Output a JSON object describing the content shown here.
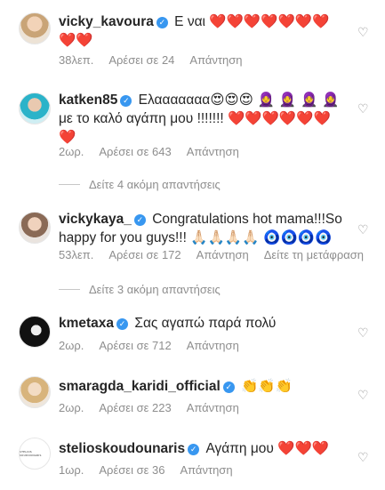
{
  "comments": [
    {
      "username": "vicky_kavoura",
      "text": "Ε ναι",
      "emojis": "❤️❤️❤️❤️❤️❤️❤️❤️❤️",
      "time": "38λεπ.",
      "likes": "Αρέσει σε 24",
      "reply": "Απάντηση",
      "translate": ""
    },
    {
      "username": "katken85",
      "text": "Ελααααααα",
      "emojis": "😍😍😍 🧕 🧕 🧕 🧕",
      "text2": "με το καλό αγάπη μου !!!!!!!",
      "emojis2": "❤️❤️❤️❤️❤️❤️❤️",
      "time": "2ωρ.",
      "likes": "Αρέσει σε 643",
      "reply": "Απάντηση",
      "translate": ""
    },
    {
      "username": "vickykaya_",
      "text": "Congratulations hot mama!!!So happy for you guys!!!",
      "emojis": "🙏🏻🙏🏻🙏🏻🙏🏻 🧿🧿🧿🧿",
      "time": "53λεπ.",
      "likes": "Αρέσει σε 172",
      "reply": "Απάντηση",
      "translate": "Δείτε τη μετάφραση"
    },
    {
      "username": "kmetaxa",
      "text": "Σας αγαπώ παρά πολύ",
      "emojis": "",
      "time": "2ωρ.",
      "likes": "Αρέσει σε 712",
      "reply": "Απάντηση",
      "translate": ""
    },
    {
      "username": "smaragda_karidi_official",
      "text": "",
      "emojis": "👏👏👏",
      "time": "2ωρ.",
      "likes": "Αρέσει σε 223",
      "reply": "Απάντηση",
      "translate": ""
    },
    {
      "username": "stelioskoudounaris",
      "text": "Αγάπη μου",
      "emojis": "❤️❤️❤️",
      "time": "1ωρ.",
      "likes": "Αρέσει σε 36",
      "reply": "Απάντηση",
      "translate": ""
    }
  ],
  "more_replies": [
    {
      "label": "Δείτε 4 ακόμη απαντήσεις"
    },
    {
      "label": "Δείτε 3 ακόμη απαντήσεις"
    }
  ],
  "avatar_logo_text": "STELIOS KOUDOUNARIS",
  "verified_glyph": "✓",
  "heart_glyph": "♡",
  "colors": {
    "text": "#262626",
    "meta": "#8e8e8e",
    "verified": "#3897f0",
    "heart_red": "#ed4956"
  }
}
